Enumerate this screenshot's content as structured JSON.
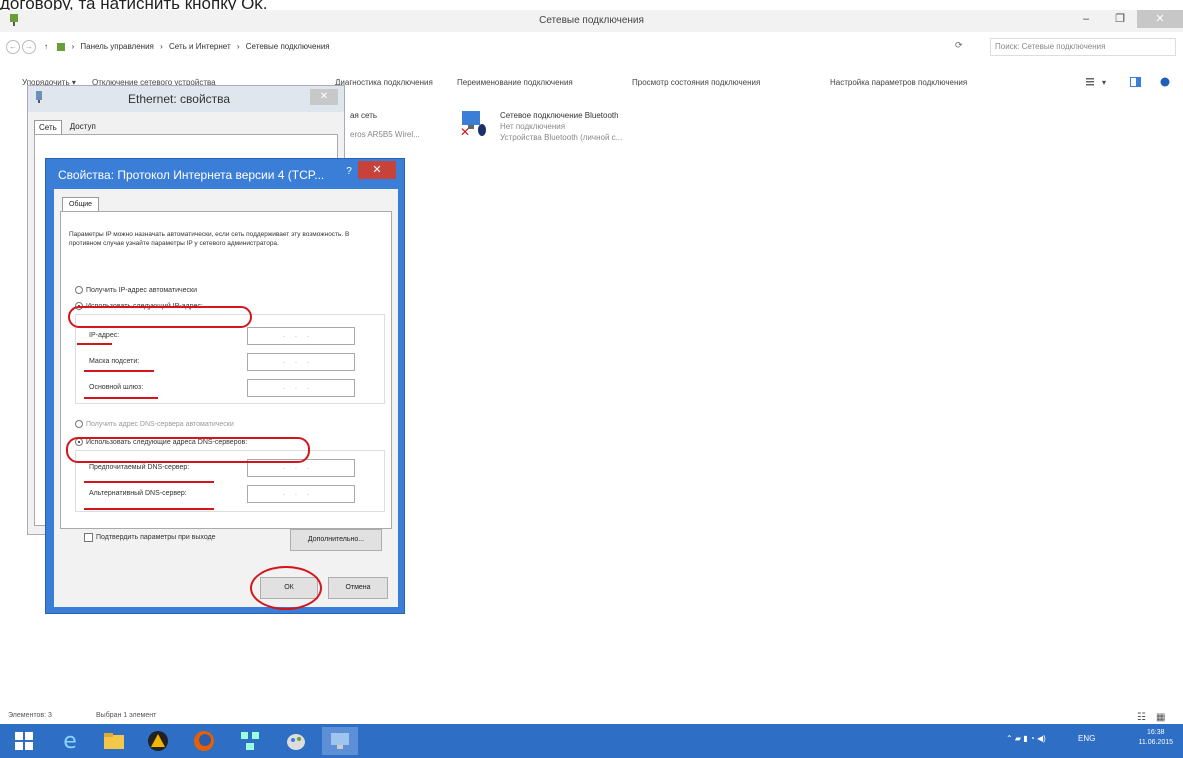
{
  "caption": "договору, та натиснить кнопку Ok.",
  "window": {
    "title": "Сетевые подключения",
    "min": "–",
    "max": "❐",
    "close": "✕"
  },
  "nav": {
    "back": "←",
    "forward": "→",
    "up": "↑"
  },
  "address": {
    "crumbs": [
      "Панель управления",
      "Сеть и Интернет",
      "Сетевые подключения"
    ],
    "sep": "›"
  },
  "search": {
    "placeholder": "Поиск: Сетевые подключения"
  },
  "commands": [
    "Упорядочить ▾",
    "Отключение сетевого устройства",
    "Диагностика подключения",
    "Переименование подключения",
    "Просмотр состояния подключения",
    "Настройка параметров подключения"
  ],
  "network_items": [
    {
      "name": "ая сеть",
      "status": "",
      "device": "eros AR5B5 Wirel..."
    },
    {
      "name": "Сетевое подключение Bluetooth",
      "status": "Нет подключения",
      "device": "Устройства Bluetooth (личной с..."
    }
  ],
  "eth_dialog": {
    "title": "Ethernet: свойства",
    "tabs": [
      "Сеть",
      "Доступ"
    ]
  },
  "ipv4_dialog": {
    "title": "Свойства: Протокол Интернета версии 4 (TCP...",
    "help": "?",
    "close": "✕",
    "tab": "Общие",
    "description": "Параметры IP можно назначать автоматически, если сеть поддерживает эту возможность. В противном случае узнайте параметры IP у сетевого администратора.",
    "radio_ip_auto": "Получить IP-адрес автоматически",
    "radio_ip_manual": "Использовать следующий IP-адрес:",
    "label_ip": "IP-адрес:",
    "label_mask": "Маска подсети:",
    "label_gateway": "Основной шлюз:",
    "radio_dns_auto": "Получить адрес DNS-сервера автоматически",
    "radio_dns_manual": "Использовать следующие адреса DNS-серверов:",
    "label_dns1": "Предпочитаемый DNS-сервер:",
    "label_dns2": "Альтернативный DNS-сервер:",
    "ip_placeholder": "...",
    "checkbox_validate": "Подтвердить параметры при выходе",
    "btn_advanced": "Дополнительно...",
    "btn_ok": "ОК",
    "btn_cancel": "Отмена"
  },
  "status": {
    "items": "Элементов: 3",
    "selected": "Выбран 1 элемент"
  },
  "taskbar": {
    "lang": "ENG",
    "time": "16:38",
    "date": "11.06.2015"
  },
  "accent": "#d4151c"
}
